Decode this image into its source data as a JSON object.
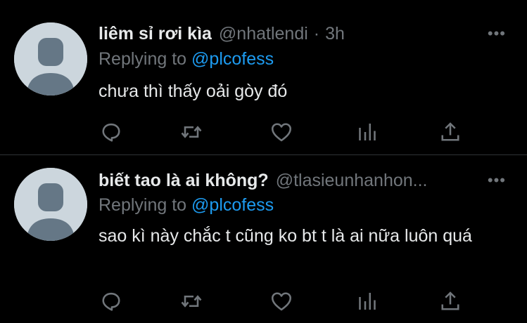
{
  "tweets": [
    {
      "display_name": "liêm sỉ rơi kìa",
      "handle": "@nhatlendi",
      "separator": "·",
      "time": "3h",
      "more_label": "•••",
      "replying_prefix": "Replying to",
      "replying_to": "@plcofess",
      "text": "chưa thì thấy oải gòy đó"
    },
    {
      "display_name": "biết tao là ai không?",
      "handle": "@tlasieunhanhon...",
      "more_label": "•••",
      "replying_prefix": "Replying to",
      "replying_to": "@plcofess",
      "text": "sao kì này chắc t cũng ko bt t là ai nữa luôn quá"
    }
  ],
  "action_icons": [
    "reply-icon",
    "retweet-icon",
    "like-icon",
    "analytics-icon",
    "share-icon"
  ],
  "colors": {
    "background": "#000000",
    "text": "#e7e9ea",
    "muted": "#71767b",
    "accent": "#1d9bf0",
    "divider": "#2f3336",
    "avatar": "#ccd6dd"
  }
}
